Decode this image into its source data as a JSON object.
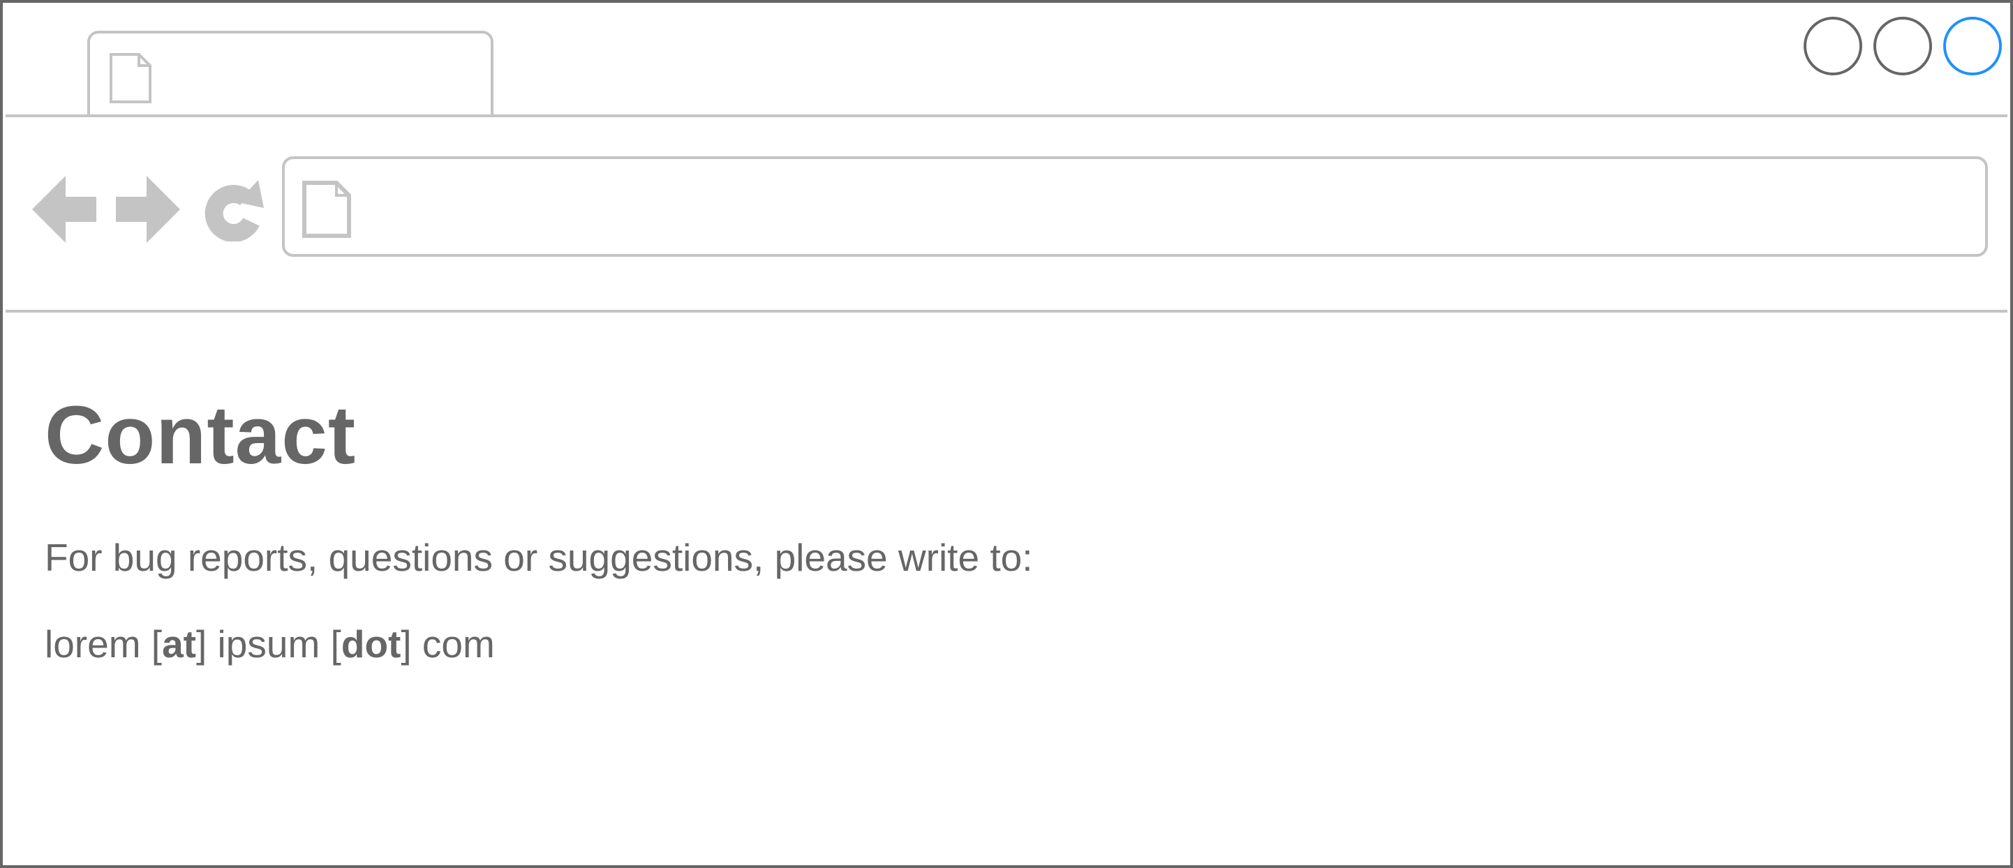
{
  "window": {
    "tab_title": "",
    "controls": {
      "minimize_icon": "circle-outline-icon",
      "maximize_icon": "circle-outline-icon",
      "close_icon": "circle-outline-icon"
    }
  },
  "toolbar": {
    "back_icon": "arrow-left-icon",
    "forward_icon": "arrow-right-icon",
    "reload_icon": "reload-icon",
    "address": {
      "value": "",
      "placeholder": "",
      "icon": "page-icon"
    }
  },
  "page": {
    "heading": "Contact",
    "intro": "For bug reports, questions or suggestions, please write to:",
    "email": {
      "part1": "lorem [",
      "at": "at",
      "part2": "] ipsum [",
      "dot": "dot",
      "part3": "] com"
    }
  },
  "colors": {
    "frame": "#666666",
    "chrome_line": "#c4c4c4",
    "text": "#666666",
    "close_accent": "#1e90ff"
  }
}
